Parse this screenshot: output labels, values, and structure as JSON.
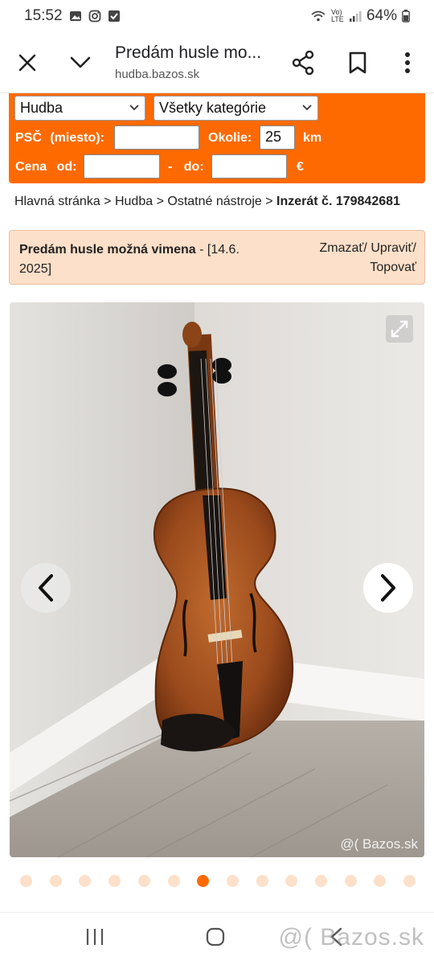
{
  "status_bar": {
    "time": "15:52",
    "battery": "64%",
    "network": "Vo) LTE"
  },
  "toolbar": {
    "title": "Predám husle mo...",
    "url": "hudba.bazos.sk",
    "icons": [
      "close-icon",
      "chevron-down-icon",
      "share-icon",
      "bookmark-icon",
      "more-vert-icon"
    ]
  },
  "search": {
    "section_value": "Hudba",
    "category_value": "Všetky kategórie",
    "psc_label": "PSČ (miesto):",
    "psc_value": "",
    "radius_label": "Okolie:",
    "radius_value": "25",
    "radius_unit": "km",
    "price_label": "Cena od:",
    "price_from_value": "",
    "price_separator": "- do:",
    "price_to_value": "",
    "currency": "€",
    "panel_color": "#ff6a00"
  },
  "breadcrumb": {
    "home": "Hlavná stránka",
    "section": "Hudba",
    "category": "Ostatné nástroje",
    "current": "Inzerát č. 179842681",
    "separator": ">"
  },
  "listing": {
    "title": "Predám husle možná vimena",
    "date": "- [14.6. 2025]",
    "actions_line1": "Zmazať/ Upraviť/",
    "actions_line2": "Topovať"
  },
  "gallery": {
    "watermark": "@( Bazos.sk",
    "dot_count": 14,
    "active_index": 6
  },
  "bottom_nav": {
    "watermark": "@( Bazos.sk",
    "icons": [
      "recent-apps-icon",
      "home-icon",
      "back-icon"
    ]
  }
}
